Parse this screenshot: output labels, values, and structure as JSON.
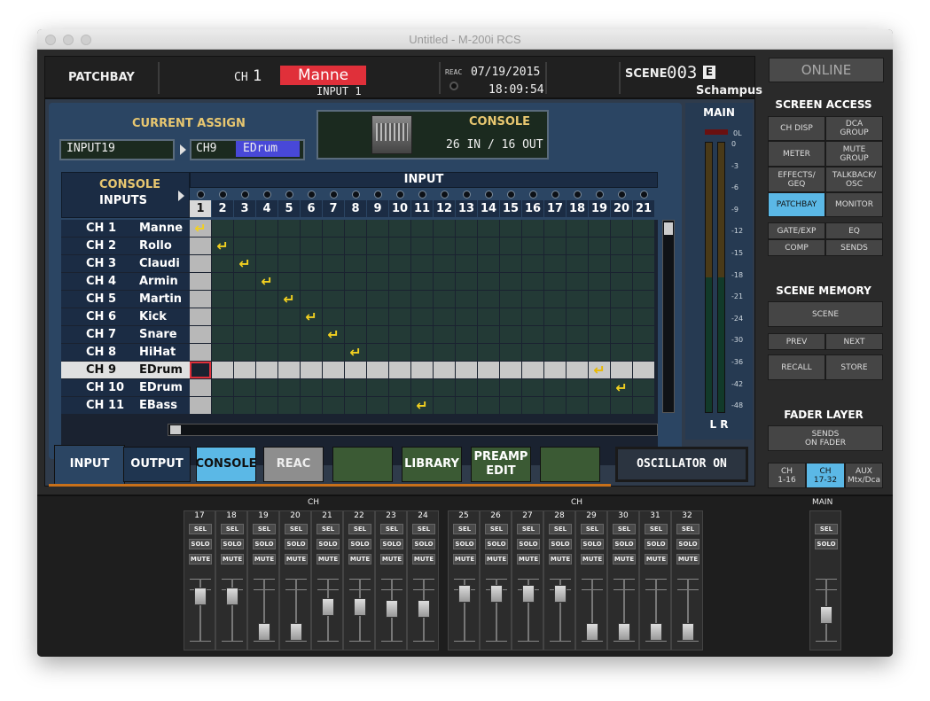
{
  "window": {
    "title": "Untitled - M-200i RCS"
  },
  "header": {
    "section": "PATCHBAY",
    "ch_label": "CH",
    "ch_number": "1",
    "ch_name": "Manne",
    "ch_input": "INPUT 1",
    "reac": "REAC",
    "date": "07/19/2015",
    "time": "18:09:54",
    "scene_label": "SCENE",
    "scene_number": "003",
    "scene_mark": "E",
    "scene_name": "Schampus"
  },
  "assign": {
    "current_assign_label": "CURRENT ASSIGN",
    "source": "INPUT19",
    "dest_ch": "CH9",
    "dest_name": "EDrum",
    "console_label": "CONSOLE",
    "console_io": "26 IN / 16 OUT"
  },
  "matrix": {
    "corner_label_1": "CONSOLE",
    "corner_label_2": "INPUTS",
    "input_header": "INPUT",
    "columns": [
      "1",
      "2",
      "3",
      "4",
      "5",
      "6",
      "7",
      "8",
      "9",
      "10",
      "11",
      "12",
      "13",
      "14",
      "15",
      "16",
      "17",
      "18",
      "19",
      "20",
      "21"
    ],
    "selected_column": 1,
    "rows": [
      {
        "ch": "CH 1",
        "name": "Manne",
        "patch": 1
      },
      {
        "ch": "CH 2",
        "name": "Rollo",
        "patch": 2
      },
      {
        "ch": "CH 3",
        "name": "Claudi",
        "patch": 3
      },
      {
        "ch": "CH 4",
        "name": "Armin",
        "patch": 4
      },
      {
        "ch": "CH 5",
        "name": "Martin",
        "patch": 5
      },
      {
        "ch": "CH 6",
        "name": "Kick",
        "patch": 6
      },
      {
        "ch": "CH 7",
        "name": "Snare",
        "patch": 7
      },
      {
        "ch": "CH 8",
        "name": "HiHat",
        "patch": 8
      },
      {
        "ch": "CH 9",
        "name": "EDrum",
        "patch": 19
      },
      {
        "ch": "CH 10",
        "name": "EDrum",
        "patch": 20
      },
      {
        "ch": "CH 11",
        "name": "EBass",
        "patch": 11
      }
    ],
    "selected_row": 9
  },
  "tabs": {
    "input": "INPUT",
    "output": "OUTPUT",
    "console": "CONSOLE",
    "reac": "REAC",
    "library": "LIBRARY",
    "preamp_edit_1": "PREAMP",
    "preamp_edit_2": "EDIT",
    "oscillator": "OSCILLATOR ON"
  },
  "meter": {
    "label": "MAIN",
    "scale": [
      "0L",
      "0",
      "3",
      "6",
      "9",
      "12",
      "15",
      "18",
      "21",
      "24",
      "30",
      "36",
      "42",
      "48"
    ],
    "lr": "L R"
  },
  "side": {
    "online": "ONLINE",
    "screen_access": "SCREEN ACCESS",
    "btn_ch_disp": "CH DISP",
    "btn_dca_group_1": "DCA",
    "btn_dca_group_2": "GROUP",
    "btn_meter": "METER",
    "btn_mute_group_1": "MUTE",
    "btn_mute_group_2": "GROUP",
    "btn_effects_1": "EFFECTS/",
    "btn_effects_2": "GEQ",
    "btn_talkback_1": "TALKBACK/",
    "btn_talkback_2": "OSC",
    "btn_patchbay": "PATCHBAY",
    "btn_monitor": "MONITOR",
    "btn_gate": "GATE/EXP",
    "btn_eq": "EQ",
    "btn_comp": "COMP",
    "btn_sends": "SENDS",
    "scene_memory": "SCENE MEMORY",
    "btn_scene": "SCENE",
    "btn_prev": "PREV",
    "btn_next": "NEXT",
    "btn_recall": "RECALL",
    "btn_store": "STORE",
    "fader_layer": "FADER LAYER",
    "btn_sends_on_fader_1": "SENDS",
    "btn_sends_on_fader_2": "ON FADER",
    "btn_ch_1_16_1": "CH",
    "btn_ch_1_16_2": "1-16",
    "btn_ch_17_32_1": "CH",
    "btn_ch_17_32_2": "17-32",
    "btn_aux_1": "AUX",
    "btn_aux_2": "Mtx/Dca"
  },
  "faders": {
    "group_label": "CH",
    "main_label": "MAIN",
    "sel": "SEL",
    "solo": "SOLO",
    "mute": "MUTE",
    "channels": [
      {
        "num": "17",
        "level": 0.82
      },
      {
        "num": "18",
        "level": 0.82
      },
      {
        "num": "19",
        "level": 0.1
      },
      {
        "num": "20",
        "level": 0.1
      },
      {
        "num": "21",
        "level": 0.6
      },
      {
        "num": "22",
        "level": 0.6
      },
      {
        "num": "23",
        "level": 0.58
      },
      {
        "num": "24",
        "level": 0.58
      },
      {
        "num": "25",
        "level": 0.88
      },
      {
        "num": "26",
        "level": 0.88
      },
      {
        "num": "27",
        "level": 0.88
      },
      {
        "num": "28",
        "level": 0.88
      },
      {
        "num": "29",
        "level": 0.1
      },
      {
        "num": "30",
        "level": 0.1
      },
      {
        "num": "31",
        "level": 0.1
      },
      {
        "num": "32",
        "level": 0.1
      }
    ],
    "main_level": 0.45
  },
  "colors": {
    "accent_red": "#e0303a",
    "selected_blue": "#5bb8e6",
    "arrow_yellow": "#f2d020",
    "label_gold": "#e8c770"
  }
}
